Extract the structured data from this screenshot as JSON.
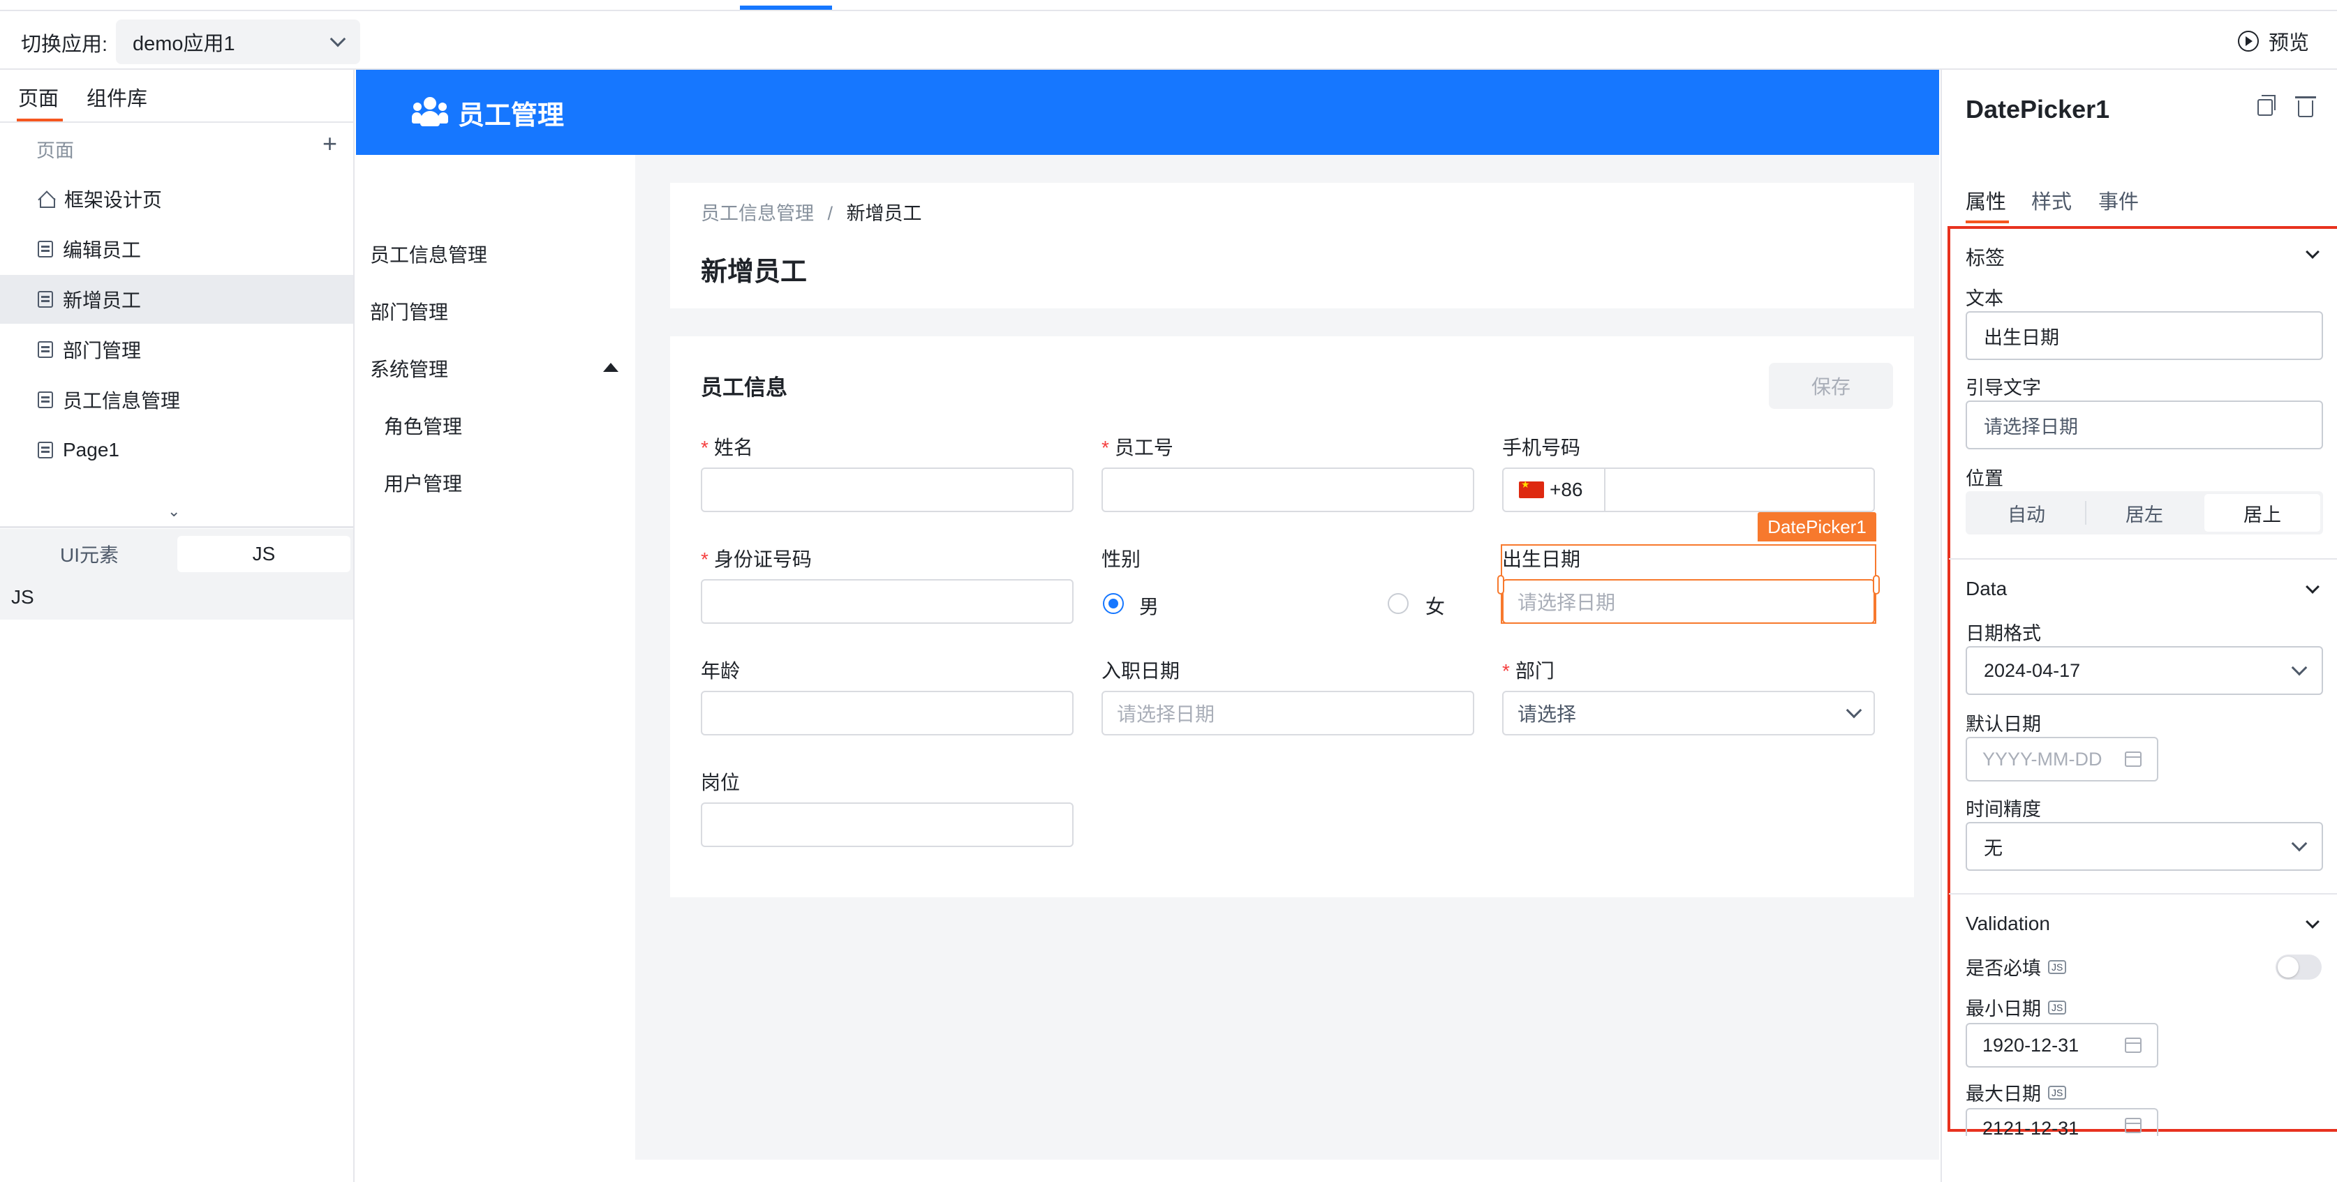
{
  "topbar": {
    "switch_label": "切换应用:",
    "app_value": "demo应用1",
    "preview_label": "预览"
  },
  "left": {
    "tabs": [
      "页面",
      "组件库"
    ],
    "pages_header": "页面",
    "pages": [
      "框架设计页",
      "编辑员工",
      "新增员工",
      "部门管理",
      "员工信息管理",
      "Page1"
    ],
    "selected_page": "新增员工",
    "segment": [
      "UI元素",
      "JS"
    ],
    "segment_selected": "JS",
    "js_row": "JS"
  },
  "app": {
    "title": "员工管理",
    "menu": [
      "员工信息管理",
      "部门管理",
      "系统管理",
      "角色管理",
      "用户管理"
    ],
    "breadcrumb": {
      "parent": "员工信息管理",
      "sep": "/",
      "current": "新增员工"
    },
    "page_title": "新增员工",
    "form": {
      "title": "员工信息",
      "save": "保存",
      "name_label": "姓名",
      "empno_label": "员工号",
      "phone_label": "手机号码",
      "phone_prefix": "+86",
      "id_label": "身份证号码",
      "gender_label": "性别",
      "gender_male": "男",
      "gender_female": "女",
      "birth_label": "出生日期",
      "birth_placeholder": "请选择日期",
      "age_label": "年龄",
      "hire_label": "入职日期",
      "hire_placeholder": "请选择日期",
      "dept_label": "部门",
      "dept_placeholder": "请选择",
      "post_label": "岗位"
    },
    "selected_component_tag": "DatePicker1"
  },
  "props": {
    "title": "DatePicker1",
    "tabs": [
      "属性",
      "样式",
      "事件"
    ],
    "label_section": "标签",
    "text_label": "文本",
    "text_value": "出生日期",
    "hint_label": "引导文字",
    "hint_value": "请选择日期",
    "position_label": "位置",
    "position_options": [
      "自动",
      "居左",
      "居上"
    ],
    "position_selected": "居上",
    "data_section": "Data",
    "format_label": "日期格式",
    "format_value": "2024-04-17",
    "default_label": "默认日期",
    "default_placeholder": "YYYY-MM-DD",
    "precision_label": "时间精度",
    "precision_value": "无",
    "validation_section": "Validation",
    "required_label": "是否必填",
    "required_on": false,
    "min_label": "最小日期",
    "min_value": "1920-12-31",
    "max_label": "最大日期",
    "max_value": "2121-12-31",
    "js_badge": "JS"
  },
  "colors": {
    "primary": "#1677ff",
    "accent": "#f5561f",
    "selection": "#f7792d",
    "highlight": "#e8321f",
    "required": "#f53f3f"
  }
}
